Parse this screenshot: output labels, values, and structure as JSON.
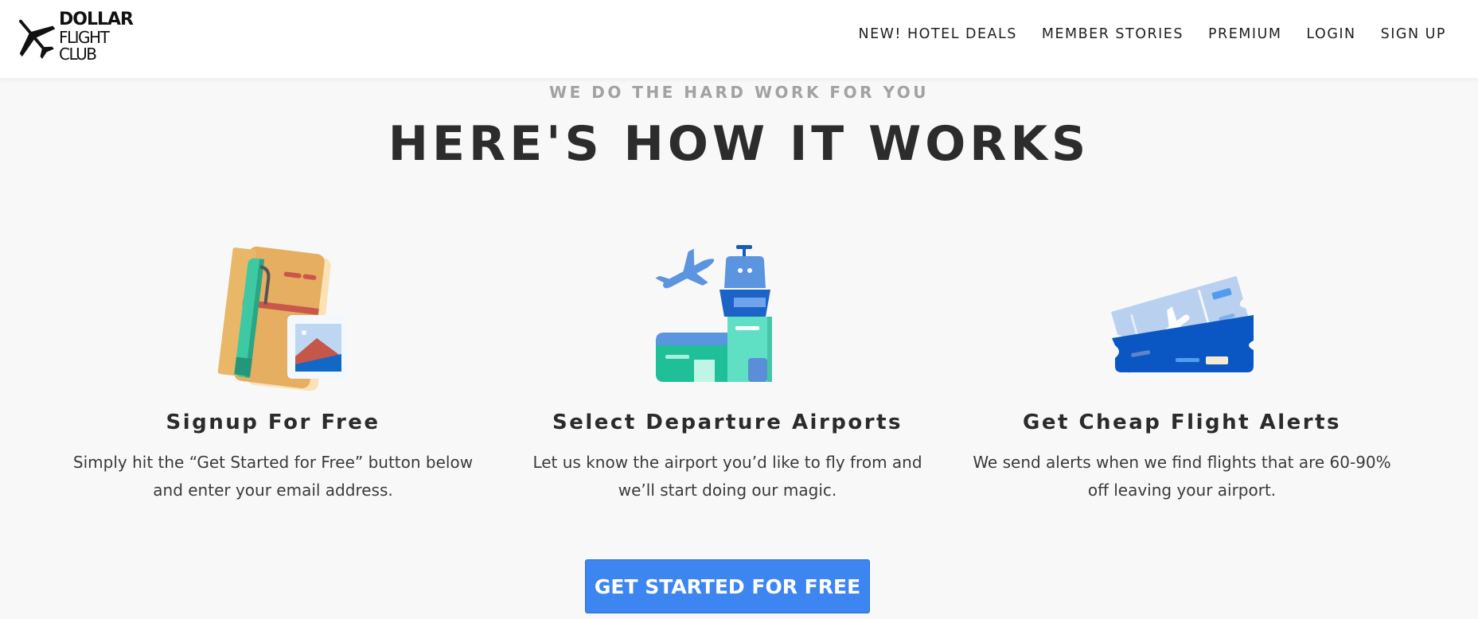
{
  "header": {
    "logo": {
      "line1": "DOLLAR",
      "line2": "FLIGHT",
      "line3": "CLUB"
    },
    "nav": [
      {
        "label": "NEW! HOTEL DEALS"
      },
      {
        "label": "MEMBER STORIES"
      },
      {
        "label": "PREMIUM"
      },
      {
        "label": "LOGIN"
      },
      {
        "label": "SIGN UP"
      }
    ]
  },
  "section": {
    "eyebrow": "WE DO THE HARD WORK FOR YOU",
    "title": "HERE'S HOW IT WORKS",
    "steps": [
      {
        "icon": "passport-icon",
        "title": "Signup For Free",
        "text": "Simply hit the “Get Started for Free” button below and enter your email address."
      },
      {
        "icon": "airport-tower-icon",
        "title": "Select Departure Airports",
        "text": "Let us know the airport you’d like to fly from and we’ll start doing our magic."
      },
      {
        "icon": "flight-ticket-icon",
        "title": "Get Cheap Flight Alerts",
        "text": "We send alerts when we find flights that are 60-90% off leaving your airport."
      }
    ],
    "cta": "GET STARTED FOR FREE"
  },
  "colors": {
    "accent": "#3d85f0",
    "background": "#f8f8f8",
    "header_bg": "#ffffff",
    "eyebrow": "#a2a2a2",
    "heading": "#2c2c2c"
  }
}
